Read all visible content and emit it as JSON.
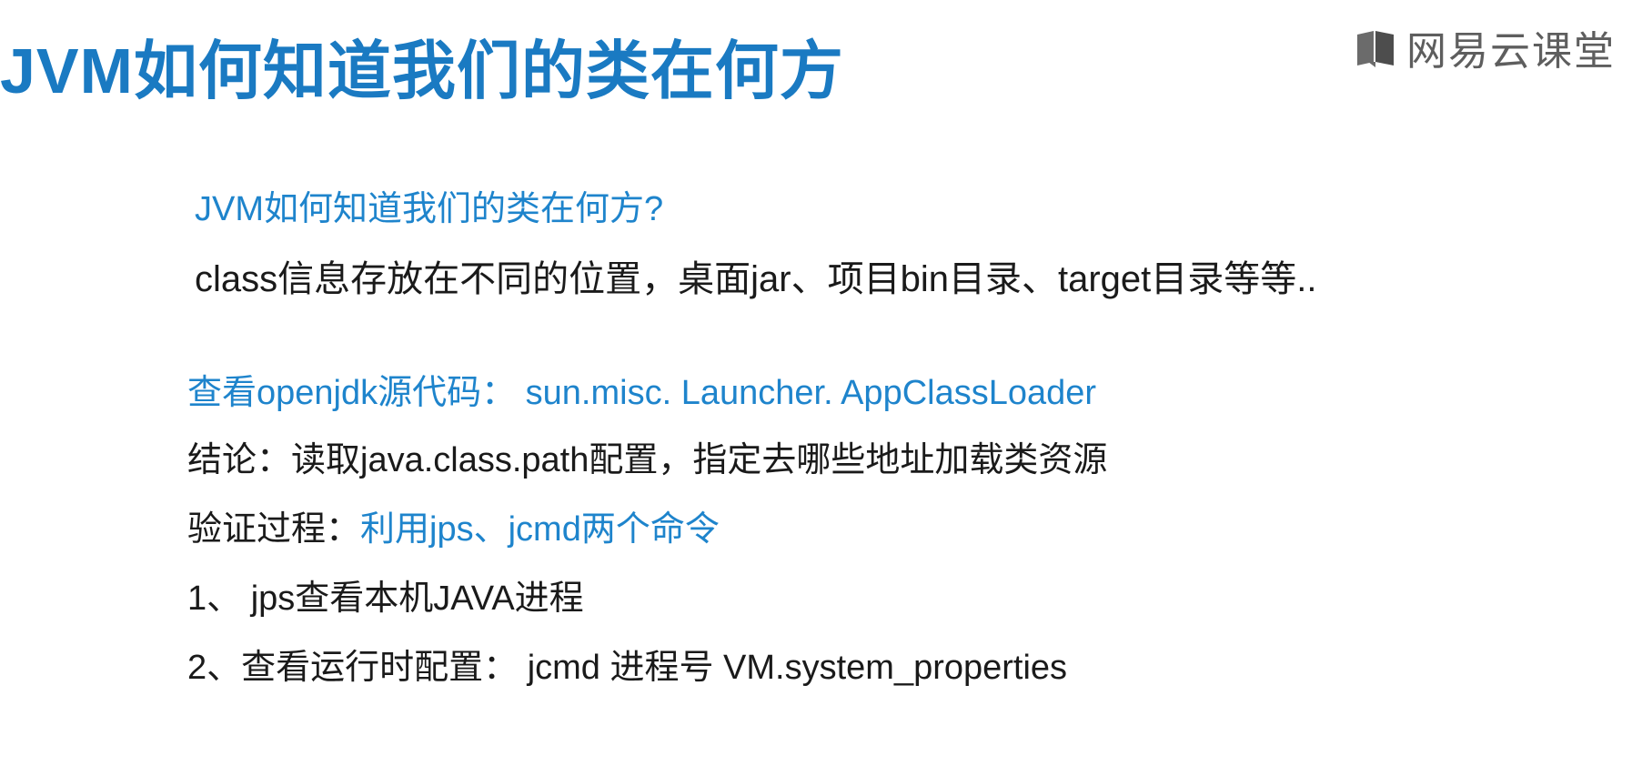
{
  "header": {
    "title": "JVM如何知道我们的类在何方",
    "brand_text": "网易云课堂",
    "brand_icon": "book-icon",
    "title_color": "#1a7ac2",
    "brand_color": "#5e5e5e"
  },
  "content": {
    "question": "JVM如何知道我们的类在何方?",
    "answer": "class信息存放在不同的位置，桌面jar、项目bin目录、target目录等等..",
    "source_line": "查看openjdk源代码： sun.misc. Launcher. AppClassLoader",
    "conclusion_label": "结论：",
    "conclusion_text": "读取java.class.path配置，指定去哪些地址加载类资源",
    "verify_label": "验证过程：",
    "verify_text": "利用jps、jcmd两个命令",
    "step1": "1、 jps查看本机JAVA进程",
    "step2": "2、查看运行时配置： jcmd  进程号  VM.system_properties",
    "accent_color": "#1e84cc"
  }
}
